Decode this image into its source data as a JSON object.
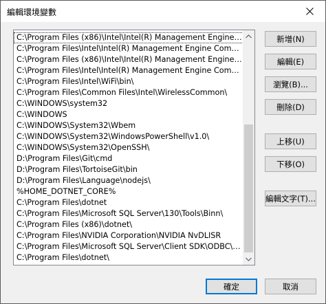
{
  "window": {
    "title": "編輯環境變數"
  },
  "list": {
    "items": [
      "C:\\Program Files (x86)\\Intel\\Intel(R) Management Engine Compon...",
      "C:\\Program Files\\Intel\\Intel(R) Management Engine Components\\...",
      "C:\\Program Files (x86)\\Intel\\Intel(R) Management Engine Compon...",
      "C:\\Program Files\\Intel\\Intel(R) Management Engine Components\\I...",
      "C:\\Program Files\\Intel\\WiFi\\bin\\",
      "C:\\Program Files\\Common Files\\Intel\\WirelessCommon\\",
      "C:\\WINDOWS\\system32",
      "C:\\WINDOWS",
      "C:\\WINDOWS\\System32\\Wbem",
      "C:\\WINDOWS\\System32\\WindowsPowerShell\\v1.0\\",
      "C:\\WINDOWS\\System32\\OpenSSH\\",
      "D:\\Program Files\\Git\\cmd",
      "D:\\Program Files\\TortoiseGit\\bin",
      "D:\\Program Files\\Language\\nodejs\\",
      "%HOME_DOTNET_CORE%",
      "C:\\Program Files\\dotnet",
      "C:\\Program Files\\Microsoft SQL Server\\130\\Tools\\Binn\\",
      "C:\\Program Files (x86)\\dotnet\\",
      "C:\\Program Files\\NVIDIA Corporation\\NVIDIA NvDLISR",
      "C:\\Program Files\\Microsoft SQL Server\\Client SDK\\ODBC\\170\\Too...",
      "C:\\Program Files\\dotnet\\"
    ]
  },
  "buttons": {
    "new": "新增(N)",
    "edit": "編輯(E)",
    "browse": "瀏覽(B)...",
    "delete": "刪除(D)",
    "move_up": "上移(U)",
    "move_down": "下移(O)",
    "edit_text": "編輯文字(T)...",
    "ok": "確定",
    "cancel": "取消"
  },
  "colors": {
    "focus_border": "#0078d7",
    "button_face": "#e1e1e1",
    "dialog_bg": "#f0f0f0"
  }
}
